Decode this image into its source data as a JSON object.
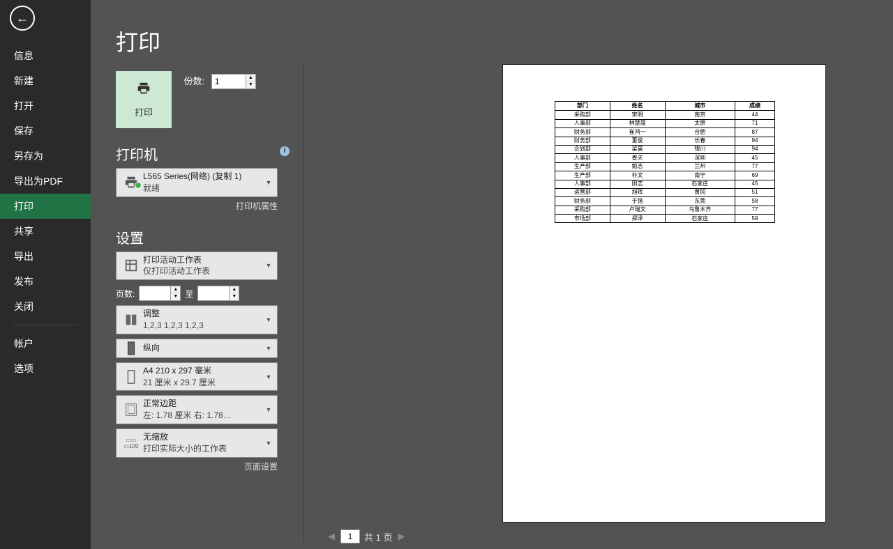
{
  "title_bar": "",
  "nav": {
    "items": [
      "信息",
      "新建",
      "打开",
      "保存",
      "另存为",
      "导出为PDF",
      "打印",
      "共享",
      "导出",
      "发布",
      "关闭"
    ],
    "active_index": 6,
    "account_items": [
      "帐户",
      "选项"
    ]
  },
  "print": {
    "page_title": "打印",
    "print_btn": "打印",
    "copies_label": "份数:",
    "copies_value": "1",
    "printer_section": "打印机",
    "printer_name": "L565 Series(网络) (复制 1)",
    "printer_status": "就绪",
    "printer_props": "打印机属性",
    "settings_section": "设置",
    "what_l1": "打印活动工作表",
    "what_l2": "仅打印活动工作表",
    "pages_label": "页数:",
    "pages_from": "",
    "pages_to_label": "至",
    "pages_to": "",
    "collate_l1": "调整",
    "collate_l2": "1,2,3    1,2,3    1,2,3",
    "orient_l1": "纵向",
    "paper_l1": "A4 210 x 297 毫米",
    "paper_l2": "21 厘米 x 29.7 厘米",
    "margins_l1": "正常边距",
    "margins_l2": "左: 1.78 厘米    右: 1.78…",
    "scale_l1": "无缩放",
    "scale_l2": "打印实际大小的工作表",
    "page_setup": "页面设置"
  },
  "pager": {
    "current": "1",
    "total_text": "共 1 页"
  },
  "chart_data": {
    "type": "table",
    "columns": [
      "部门",
      "姓名",
      "城市",
      "成绩"
    ],
    "rows": [
      [
        "采购部",
        "宋明",
        "南京",
        "44"
      ],
      [
        "人事部",
        "林楚晟",
        "太原",
        "71"
      ],
      [
        "财务部",
        "崔鸿一",
        "合肥",
        "87"
      ],
      [
        "财务部",
        "董俊",
        "长春",
        "94"
      ],
      [
        "企划部",
        "梁昊",
        "银川",
        "94"
      ],
      [
        "人事部",
        "姜天",
        "深圳",
        "45"
      ],
      [
        "生产部",
        "魁志",
        "兰州",
        "77"
      ],
      [
        "生产部",
        "朴文",
        "南宁",
        "69"
      ],
      [
        "人事部",
        "田志",
        "石家庄",
        "45"
      ],
      [
        "运营部",
        "旭晖",
        "黄冈",
        "51"
      ],
      [
        "财务部",
        "于锴",
        "东莞",
        "58"
      ],
      [
        "采购部",
        "卢瑞文",
        "乌鲁木齐",
        "77"
      ],
      [
        "市场部",
        "郑泽",
        "石家庄",
        "59"
      ]
    ]
  }
}
